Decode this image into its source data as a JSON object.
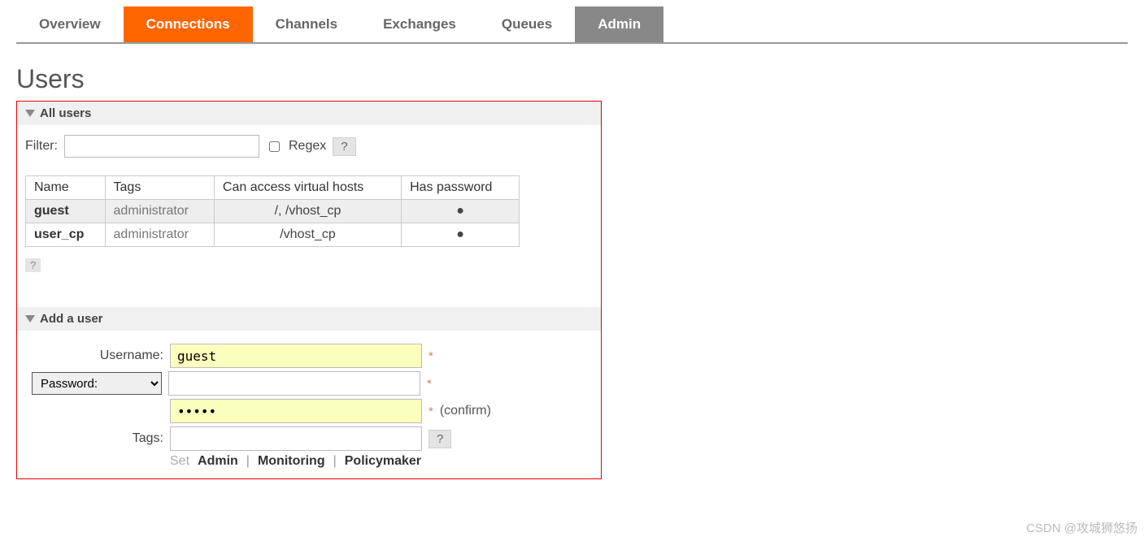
{
  "tabs": {
    "overview": "Overview",
    "connections": "Connections",
    "channels": "Channels",
    "exchanges": "Exchanges",
    "queues": "Queues",
    "admin": "Admin"
  },
  "page_title": "Users",
  "sections": {
    "all_users": "All users",
    "add_user": "Add a user"
  },
  "filter": {
    "label": "Filter:",
    "value": "",
    "regex_label": "Regex",
    "help": "?"
  },
  "table": {
    "headers": {
      "name": "Name",
      "tags": "Tags",
      "vhosts": "Can access virtual hosts",
      "password": "Has password"
    },
    "rows": [
      {
        "name": "guest",
        "tags": "administrator",
        "vhosts": "/, /vhost_cp",
        "password": "●"
      },
      {
        "name": "user_cp",
        "tags": "administrator",
        "vhosts": "/vhost_cp",
        "password": "●"
      }
    ]
  },
  "help_below": "?",
  "form": {
    "username_label": "Username:",
    "username_value": "guest",
    "password_option": "Password:",
    "password_value": "",
    "confirm_value": "•••••",
    "confirm_label": "(confirm)",
    "tags_label": "Tags:",
    "tags_value": "",
    "tags_help": "?",
    "required": "*",
    "set_label": "Set",
    "links": {
      "admin": "Admin",
      "monitoring": "Monitoring",
      "policymaker": "Policymaker"
    },
    "sep": "|"
  },
  "watermark": "CSDN @攻城狮悠扬"
}
